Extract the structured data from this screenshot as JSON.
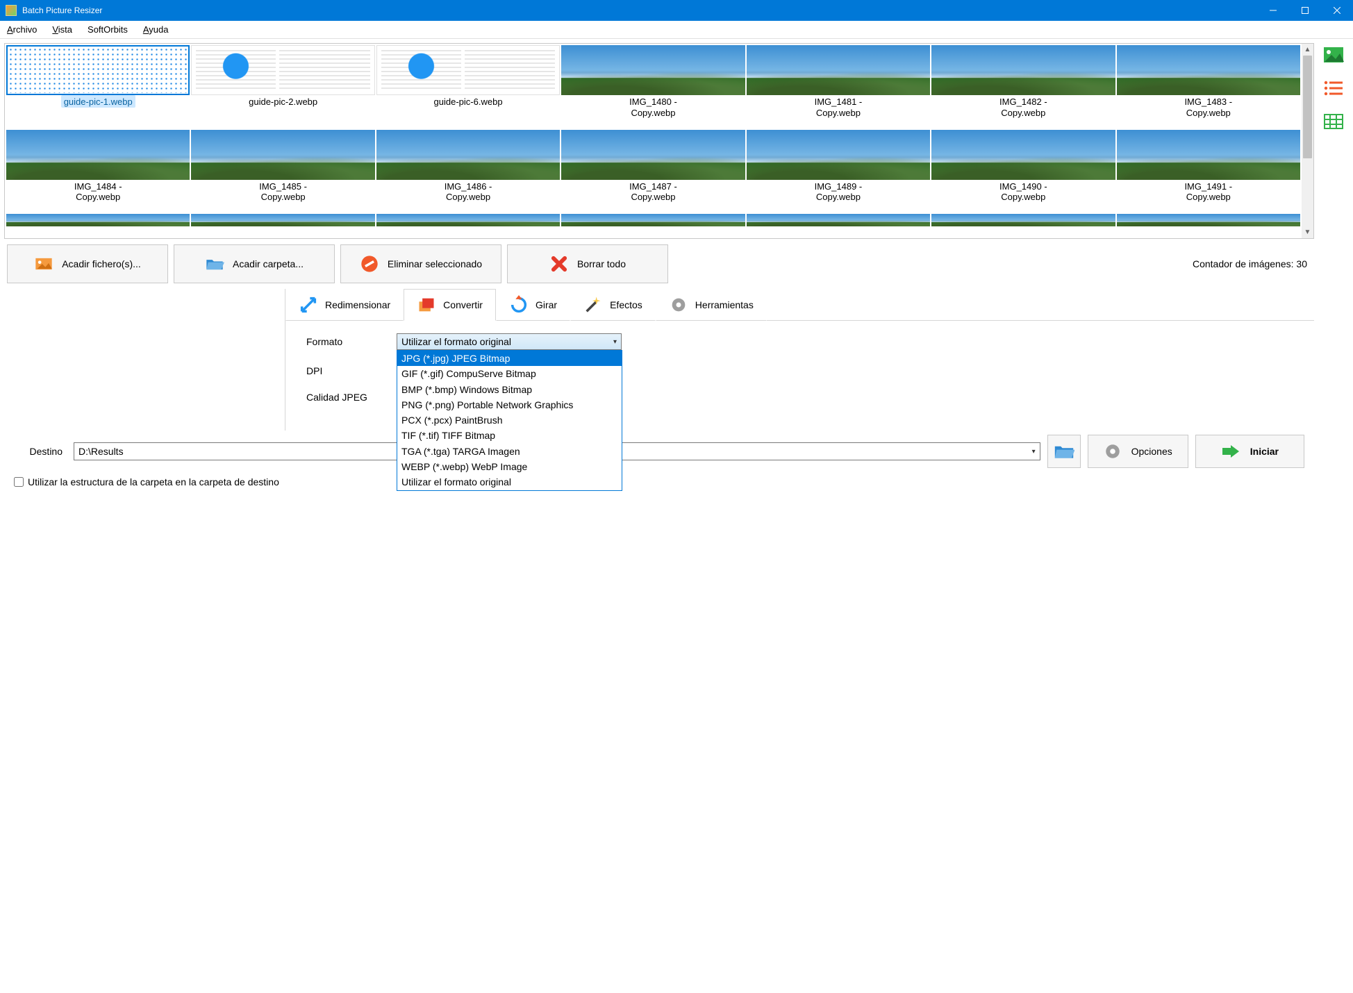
{
  "window": {
    "title": "Batch Picture Resizer"
  },
  "menubar": {
    "items": [
      {
        "label": "Archivo",
        "underline_index": 0
      },
      {
        "label": "Vista",
        "underline_index": 0
      },
      {
        "label": "SoftOrbits",
        "underline_index": -1
      },
      {
        "label": "Ayuda",
        "underline_index": 0
      }
    ]
  },
  "thumbs": [
    {
      "name": "guide-pic-1.webp",
      "style": "dotgrid",
      "selected": true
    },
    {
      "name": "guide-pic-2.webp",
      "style": "doc blue"
    },
    {
      "name": "guide-pic-6.webp",
      "style": "doc blue"
    },
    {
      "name": "IMG_1480 -\nCopy.webp",
      "style": "mountain"
    },
    {
      "name": "IMG_1481 -\nCopy.webp",
      "style": "mountain"
    },
    {
      "name": "IMG_1482 -\nCopy.webp",
      "style": "mountain"
    },
    {
      "name": "IMG_1483 -\nCopy.webp",
      "style": "mountain"
    },
    {
      "name": "IMG_1484 -\nCopy.webp",
      "style": "mountain"
    },
    {
      "name": "IMG_1485 -\nCopy.webp",
      "style": "mountain"
    },
    {
      "name": "IMG_1486 -\nCopy.webp",
      "style": "mountain"
    },
    {
      "name": "IMG_1487 -\nCopy.webp",
      "style": "mountain"
    },
    {
      "name": "IMG_1489 -\nCopy.webp",
      "style": "mountain"
    },
    {
      "name": "IMG_1490 -\nCopy.webp",
      "style": "mountain"
    },
    {
      "name": "IMG_1491 -\nCopy.webp",
      "style": "mountain"
    }
  ],
  "toolbar": {
    "add_files": "Acadir fichero(s)...",
    "add_folder": "Acadir carpeta...",
    "delete_sel": "Eliminar seleccionado",
    "clear_all": "Borrar todo",
    "counter_label": "Contador de imágenes:",
    "counter_value": "30"
  },
  "tabs": {
    "resize": "Redimensionar",
    "convert": "Convertir",
    "rotate": "Girar",
    "effects": "Efectos",
    "tools": "Herramientas"
  },
  "convert": {
    "label_format": "Formato",
    "label_dpi": "DPI",
    "label_quality": "Calidad JPEG",
    "selected": "Utilizar el formato original",
    "options": [
      "JPG (*.jpg) JPEG Bitmap",
      "GIF (*.gif) CompuServe Bitmap",
      "BMP (*.bmp) Windows Bitmap",
      "PNG (*.png) Portable Network Graphics",
      "PCX (*.pcx) PaintBrush",
      "TIF (*.tif) TIFF Bitmap",
      "TGA (*.tga) TARGA Imagen",
      "WEBP (*.webp) WebP Image",
      "Utilizar el formato original"
    ]
  },
  "bottom": {
    "dest_label": "Destino",
    "dest_value": "D:\\Results",
    "options": "Opciones",
    "start": "Iniciar",
    "chk_label": "Utilizar la estructura de la carpeta en la carpeta de destino"
  }
}
